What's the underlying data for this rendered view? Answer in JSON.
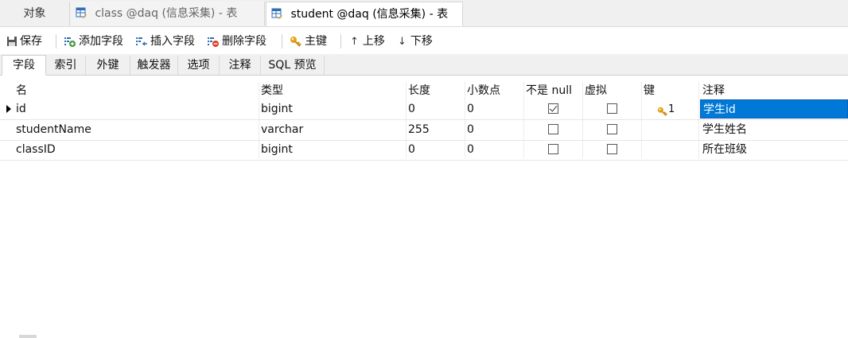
{
  "doc_tabs": [
    {
      "label": "对象"
    },
    {
      "label": "class @daq (信息采集) - 表"
    },
    {
      "label": "student @daq (信息采集) - 表"
    }
  ],
  "toolbar": {
    "save": "保存",
    "add_field": "添加字段",
    "insert_field": "插入字段",
    "delete_field": "删除字段",
    "primary_key": "主键",
    "move_up": "上移",
    "move_down": "下移"
  },
  "sub_tabs": [
    {
      "label": "字段"
    },
    {
      "label": "索引"
    },
    {
      "label": "外键"
    },
    {
      "label": "触发器"
    },
    {
      "label": "选项"
    },
    {
      "label": "注释"
    },
    {
      "label": "SQL 预览"
    }
  ],
  "columns": {
    "name": "名",
    "type": "类型",
    "length": "长度",
    "decimals": "小数点",
    "not_null": "不是 null",
    "virtual": "虚拟",
    "key": "键",
    "comment": "注释"
  },
  "rows": [
    {
      "name": "id",
      "type": "bigint",
      "length": "0",
      "decimals": "0",
      "not_null": true,
      "virtual": false,
      "key": "1",
      "comment": "学生id"
    },
    {
      "name": "studentName",
      "type": "varchar",
      "length": "255",
      "decimals": "0",
      "not_null": false,
      "virtual": false,
      "key": "",
      "comment": "学生姓名"
    },
    {
      "name": "classID",
      "type": "bigint",
      "length": "0",
      "decimals": "0",
      "not_null": false,
      "virtual": false,
      "key": "",
      "comment": "所在班级"
    }
  ],
  "colors": {
    "selection": "#0078d7",
    "key_icon": "#e8a317"
  }
}
